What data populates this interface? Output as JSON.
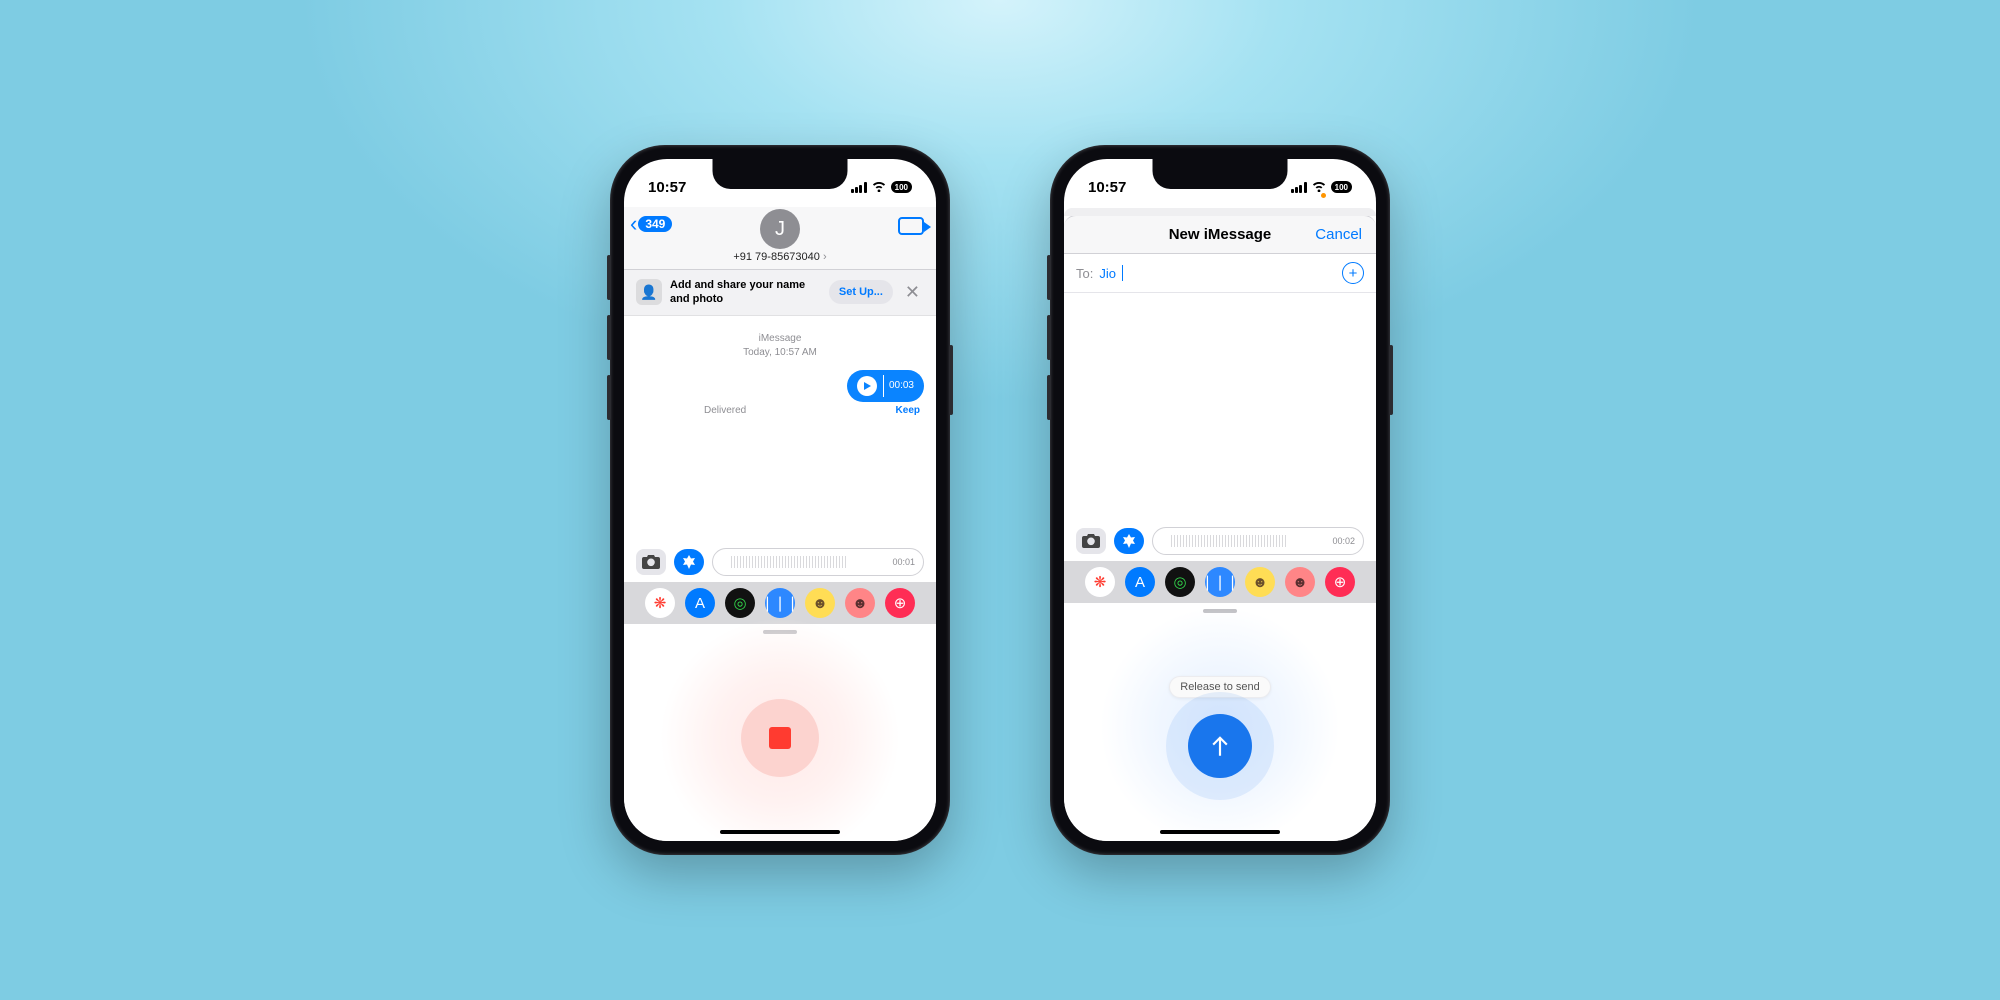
{
  "status": {
    "time": "10:57",
    "battery": "100"
  },
  "phone1": {
    "back_badge": "349",
    "avatar_initial": "J",
    "contact": "+91 79-85673040",
    "banner": {
      "text": "Add and share your name and photo",
      "setup": "Set Up..."
    },
    "thread": {
      "service": "iMessage",
      "timestamp": "Today, 10:57 AM"
    },
    "voice": {
      "duration": "00:03",
      "delivered": "Delivered",
      "keep": "Keep"
    },
    "compose_duration": "00:01"
  },
  "phone2": {
    "title": "New iMessage",
    "cancel": "Cancel",
    "to_label": "To:",
    "to_value": "Jio",
    "compose_duration": "00:02",
    "release_hint": "Release to send"
  },
  "app_icons": [
    {
      "name": "photos-app-icon",
      "bg": "#fff",
      "glyph": "❋",
      "color": "#ff3b30"
    },
    {
      "name": "appstore-app-icon",
      "bg": "#007aff",
      "glyph": "A"
    },
    {
      "name": "fitness-app-icon",
      "bg": "#111",
      "glyph": "◎",
      "color": "#32d74b"
    },
    {
      "name": "audio-message-icon",
      "bg": "#2d88ff",
      "glyph": "❘❘❘"
    },
    {
      "name": "memoji-app-icon",
      "bg": "#ffdd55",
      "glyph": "☻",
      "color": "#6b4f2b"
    },
    {
      "name": "animoji-app-icon",
      "bg": "#ff8587",
      "glyph": "☻",
      "color": "#5a2f2f"
    },
    {
      "name": "images-app-icon",
      "bg": "#ff2d55",
      "glyph": "⊕"
    }
  ]
}
